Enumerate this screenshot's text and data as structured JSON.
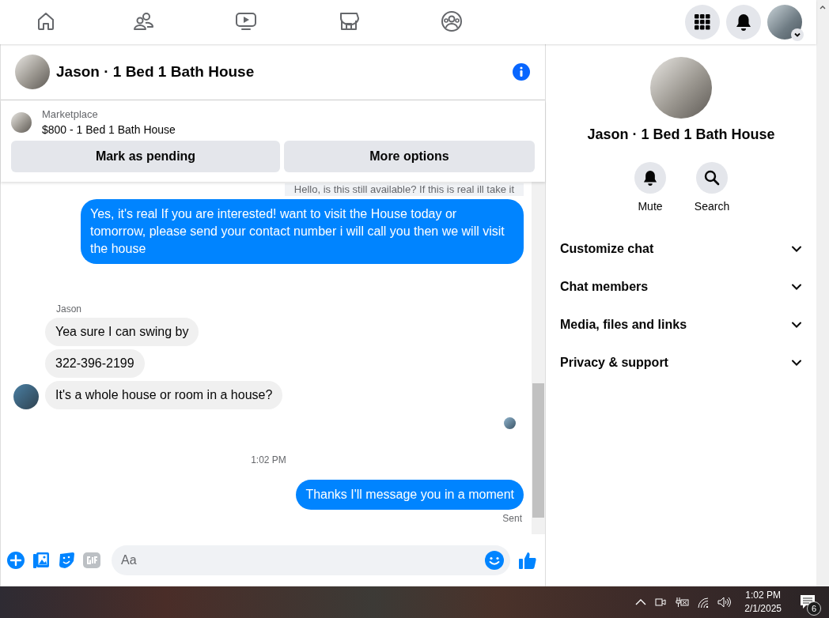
{
  "nav": {
    "tabs": [
      {
        "kind": "home",
        "selected": false
      },
      {
        "kind": "friends",
        "selected": false
      },
      {
        "kind": "video",
        "selected": false
      },
      {
        "kind": "marketplace",
        "selected": false
      },
      {
        "kind": "groups",
        "selected": false
      }
    ]
  },
  "chat": {
    "title": "Jason · 1 Bed 1 Bath House",
    "listing": {
      "label": "Marketplace",
      "title": "$800 - 1 Bed 1 Bath House",
      "buttons": [
        "Mark as pending",
        "More options"
      ]
    },
    "messages": [
      {
        "kind": "outgoing-cut",
        "text": "Hello, is this still available? If this is real ill take it"
      },
      {
        "kind": "outgoing",
        "text": "Yes, it's real If you are interested! want to visit the House today or tomorrow, please send your contact number i will call you then we will visit the house"
      },
      {
        "kind": "sender",
        "text": "Jason"
      },
      {
        "kind": "incoming",
        "text": "Yea sure I can swing by",
        "avatar": false
      },
      {
        "kind": "incoming",
        "text": "322-396-2199",
        "avatar": false
      },
      {
        "kind": "incoming",
        "text": "It's a whole house or room in a house?",
        "avatar": true
      },
      {
        "kind": "seen"
      },
      {
        "kind": "time",
        "text": "1:02 PM"
      },
      {
        "kind": "outgoing",
        "text": "Thanks I'll message you in a moment"
      },
      {
        "kind": "status",
        "text": "Sent"
      }
    ],
    "composer": {
      "placeholder": "Aa"
    }
  },
  "details": {
    "name": "Jason · 1 Bed 1 Bath House",
    "actions": [
      {
        "kind": "bell",
        "label": "Mute"
      },
      {
        "kind": "search",
        "label": "Search"
      }
    ],
    "sections": [
      {
        "label": "Customize chat",
        "expanded": false
      },
      {
        "label": "Chat members",
        "expanded": false
      },
      {
        "label": "Media, files and links",
        "expanded": false
      },
      {
        "label": "Privacy & support",
        "expanded": false
      }
    ]
  },
  "taskbar": {
    "time": "1:02 PM",
    "date": "2/1/2025",
    "notifications": "6"
  }
}
